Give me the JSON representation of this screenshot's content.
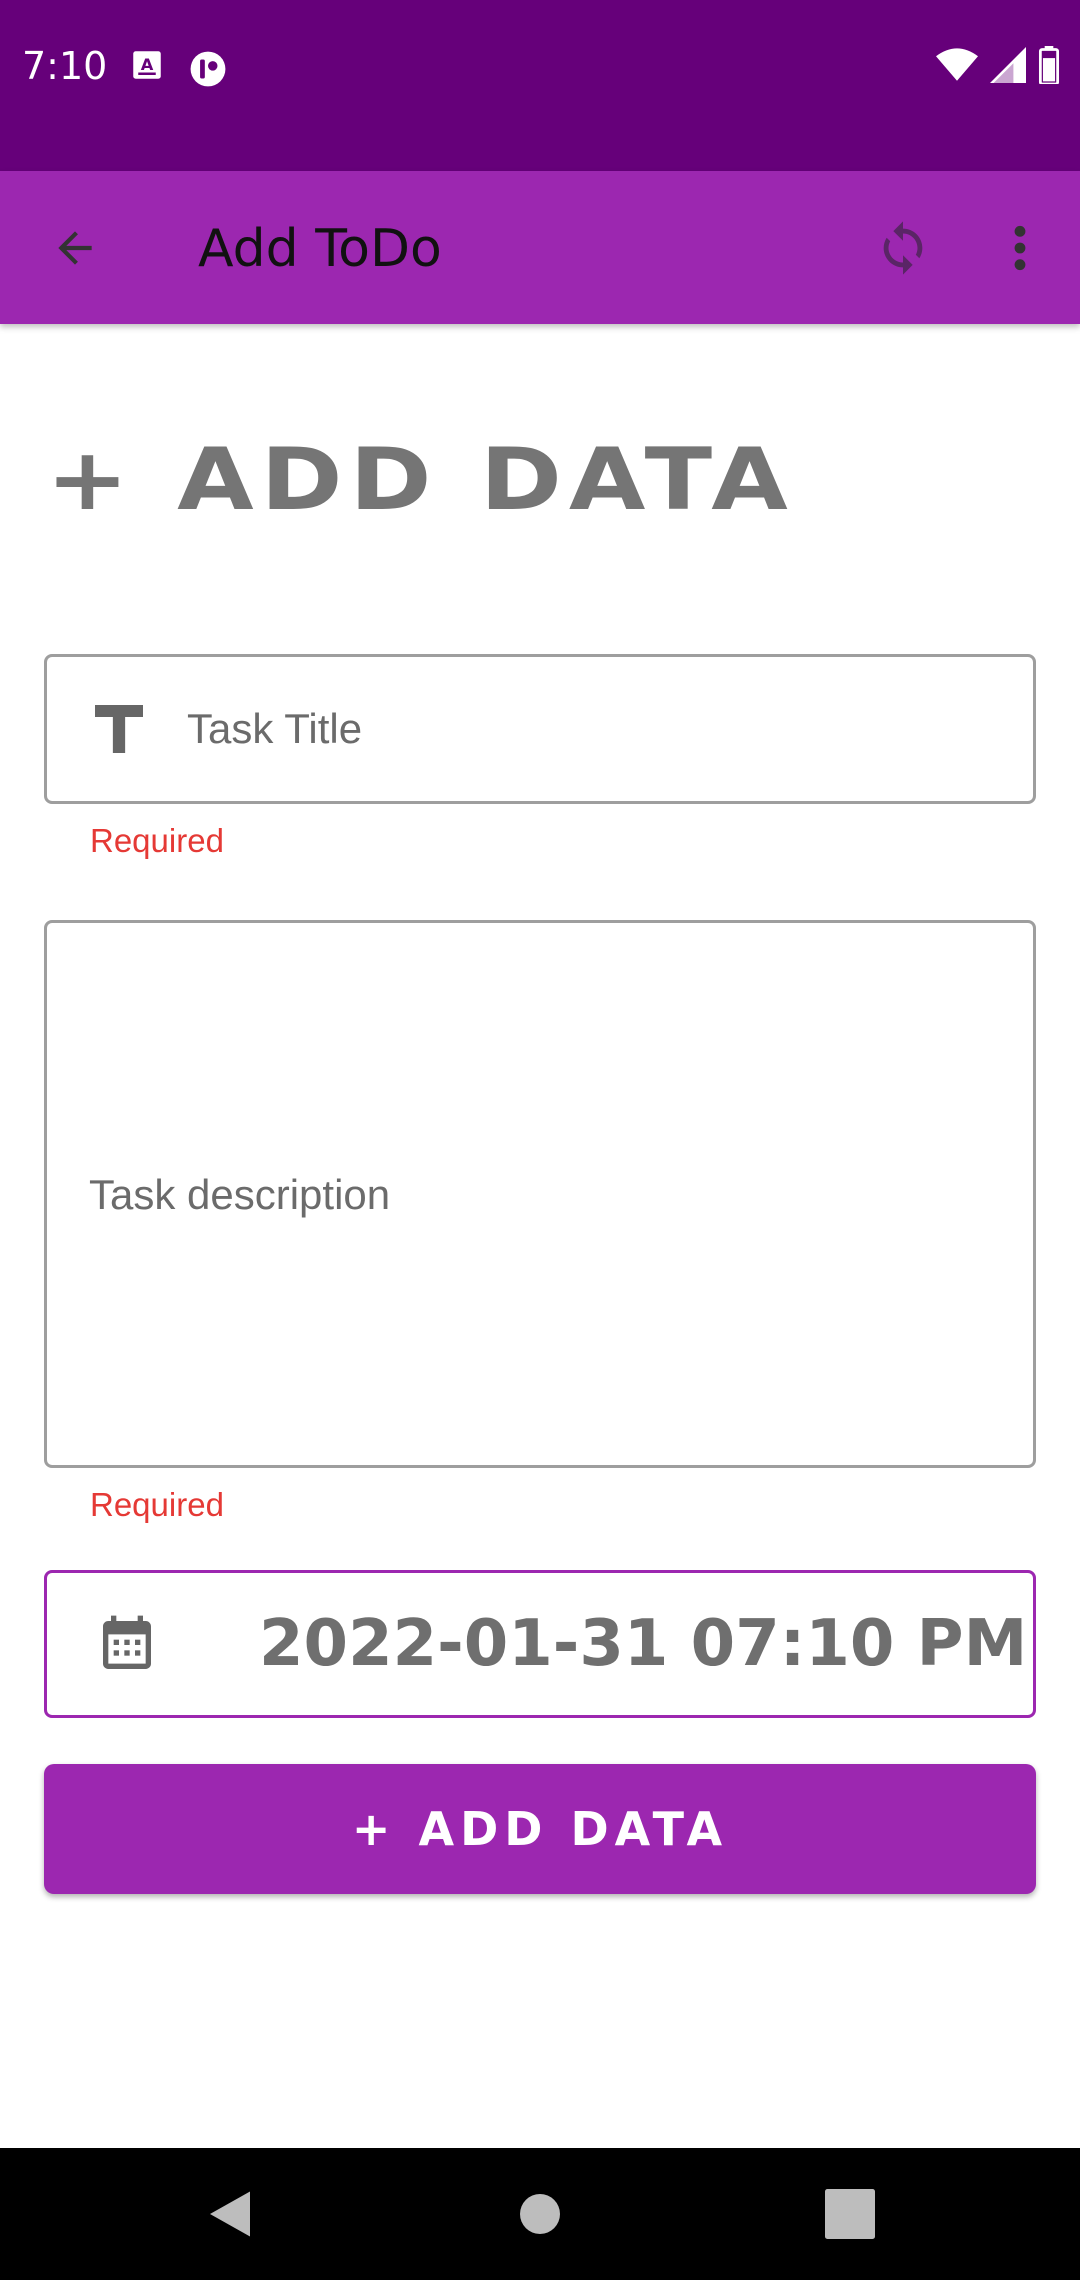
{
  "status_bar": {
    "time": "7:10",
    "notification_icons": [
      "keyboard-a-icon",
      "app-circle-icon"
    ],
    "right_icons": [
      "wifi-icon",
      "signal-icon",
      "battery-icon"
    ]
  },
  "app_bar": {
    "title": "Add ToDo",
    "back_icon": "arrow-back-icon",
    "sync_icon": "sync-icon",
    "more_icon": "more-vert-icon"
  },
  "form": {
    "heading": "+ ADD DATA",
    "title_placeholder": "Task Title",
    "title_value": "",
    "title_error": "Required",
    "description_placeholder": "Task description",
    "description_value": "",
    "description_error": "Required",
    "date_value": "2022-01-31 07:10 PM",
    "submit_label": "+ ADD DATA"
  },
  "colors": {
    "status_bar": "#66007a",
    "app_bar": "#9c27b0",
    "accent": "#9c27b0",
    "error": "#e53935",
    "heading_gray": "#757575"
  },
  "nav_bar": {
    "icons": [
      "nav-back-icon",
      "nav-home-icon",
      "nav-recents-icon"
    ]
  }
}
